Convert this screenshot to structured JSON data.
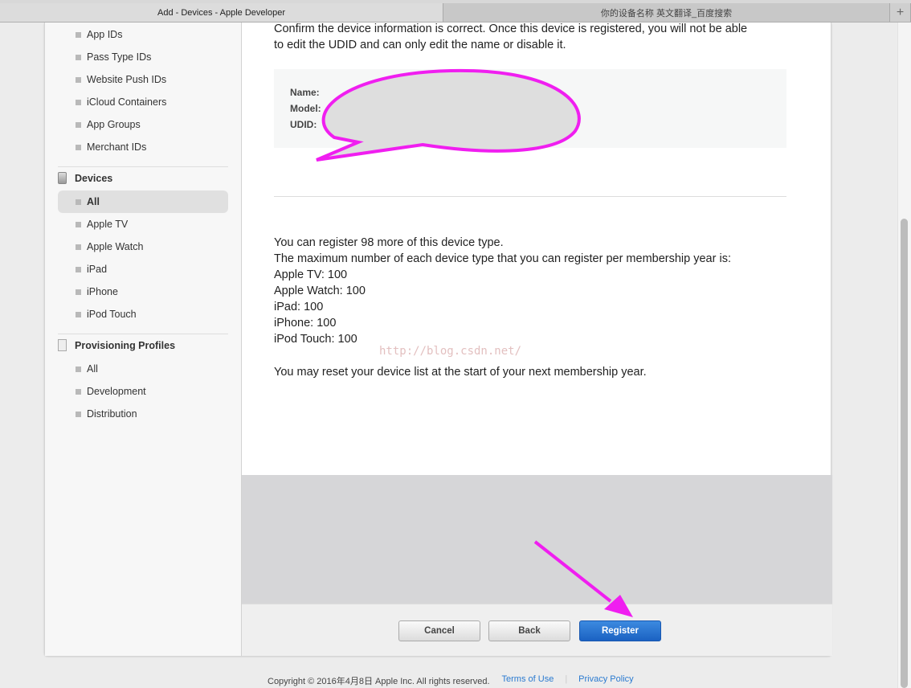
{
  "browser": {
    "tabs": [
      {
        "label": "Add - Devices - Apple Developer",
        "active": true
      },
      {
        "label": "你的设备名称 英文翻译_百度搜索",
        "active": false
      }
    ],
    "new_tab": "+"
  },
  "sidebar": {
    "identifiers": [
      "App IDs",
      "Pass Type IDs",
      "Website Push IDs",
      "iCloud Containers",
      "App Groups",
      "Merchant IDs"
    ],
    "devices": {
      "title": "Devices",
      "items": [
        "All",
        "Apple TV",
        "Apple Watch",
        "iPad",
        "iPhone",
        "iPod Touch"
      ],
      "selected": "All"
    },
    "profiles": {
      "title": "Provisioning Profiles",
      "items": [
        "All",
        "Development",
        "Distribution"
      ]
    }
  },
  "main": {
    "confirm_line1": "Confirm the device information is correct. Once this device is registered, you will not be able",
    "confirm_line2": "to edit the UDID and can only edit the name or disable it.",
    "info": {
      "name_label": "Name:",
      "model_label": "Model:",
      "udid_label": "UDID:"
    },
    "limits": [
      "You can register 98 more of this device type.",
      "The maximum number of each device type that you can register per membership year is:",
      "Apple TV: 100",
      "Apple Watch: 100",
      "iPad: 100",
      "iPhone: 100",
      "iPod Touch: 100"
    ],
    "reset_note": "You may reset your device list at the start of your next membership year.",
    "watermark": "http://blog.csdn.net/"
  },
  "buttons": {
    "cancel": "Cancel",
    "back": "Back",
    "register": "Register"
  },
  "footer": {
    "copyright": "Copyright © 2016年4月8日 Apple Inc. All rights reserved.",
    "terms": "Terms of Use",
    "privacy": "Privacy Policy"
  },
  "colors": {
    "annotation": "#f01ef0",
    "primary_button": "#1f67c8",
    "link": "#2a7ad0"
  }
}
